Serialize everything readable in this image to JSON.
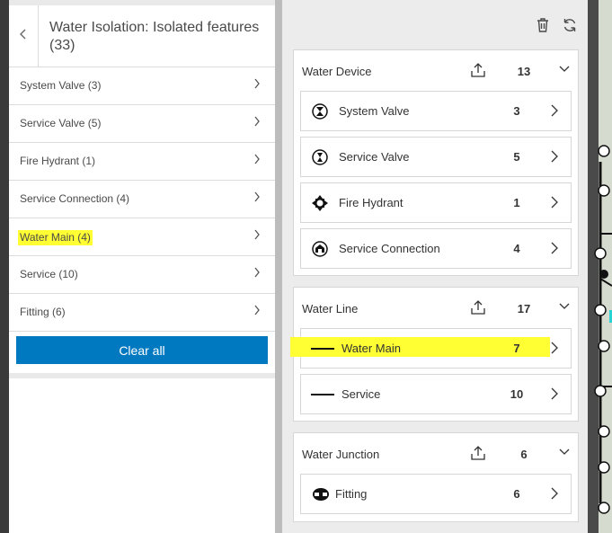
{
  "left_panel": {
    "title": "Water Isolation: Isolated features (33)",
    "back_icon": "chevron-left-icon",
    "items": [
      {
        "label": "System Valve (3)"
      },
      {
        "label": "Service Valve (5)"
      },
      {
        "label": "Fire Hydrant (1)"
      },
      {
        "label": "Service Connection (4)"
      },
      {
        "label": "Water Main (4)",
        "highlighted": true
      },
      {
        "label": "Service (10)"
      },
      {
        "label": "Fitting (6)"
      }
    ],
    "clear_all_label": "Clear all"
  },
  "right_panel": {
    "toolbar": {
      "delete_icon": "trash-icon",
      "refresh_icon": "refresh-icon"
    },
    "groups": [
      {
        "title": "Water Device",
        "count": "13",
        "rows": [
          {
            "label": "System Valve",
            "count": "3",
            "icon": "system-valve-icon"
          },
          {
            "label": "Service Valve",
            "count": "5",
            "icon": "service-valve-icon"
          },
          {
            "label": "Fire Hydrant",
            "count": "1",
            "icon": "fire-hydrant-icon"
          },
          {
            "label": "Service Connection",
            "count": "4",
            "icon": "service-connection-icon"
          }
        ]
      },
      {
        "title": "Water Line",
        "count": "17",
        "rows": [
          {
            "label": "Water Main",
            "count": "7",
            "icon": "line-icon",
            "highlighted": true
          },
          {
            "label": "Service",
            "count": "10",
            "icon": "line-icon"
          }
        ]
      },
      {
        "title": "Water Junction",
        "count": "6",
        "rows": [
          {
            "label": "Fitting",
            "count": "6",
            "icon": "fitting-icon"
          }
        ]
      }
    ]
  },
  "colors": {
    "accent": "#0079c1",
    "highlight": "#ffff33",
    "panel_bg": "#ececec"
  }
}
